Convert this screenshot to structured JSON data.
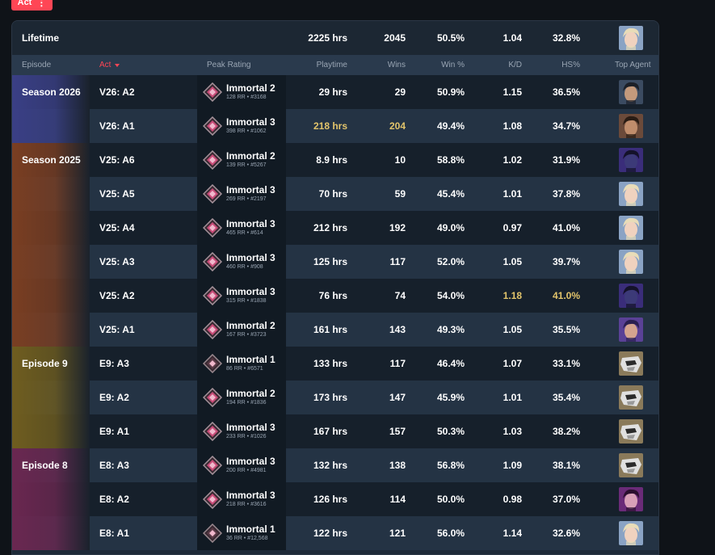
{
  "act_button": {
    "label": "Act",
    "menu_icon": "more-vertical-icon"
  },
  "lifetime": {
    "label": "Lifetime",
    "playtime": "2225 hrs",
    "wins": "2045",
    "win_pct": "50.5%",
    "kd": "1.04",
    "hs_pct": "32.8%",
    "agent": "blonde"
  },
  "headers": {
    "episode": "Episode",
    "act": "Act",
    "peak_rating": "Peak Rating",
    "playtime": "Playtime",
    "wins": "Wins",
    "win_pct": "Win %",
    "kd": "K/D",
    "hs_pct": "HS%",
    "top_agent": "Top Agent"
  },
  "episodes": [
    {
      "label": "Season 2026",
      "rows": 2,
      "color": "#3a3f85"
    },
    {
      "label": "Season 2025",
      "rows": 6,
      "color": "#7a3e22"
    },
    {
      "label": "Episode 9",
      "rows": 3,
      "color": "#6f5d1f"
    },
    {
      "label": "Episode 8",
      "rows": 3,
      "color": "#6a2750"
    }
  ],
  "rows": [
    {
      "act": "V26: A2",
      "rank": "Immortal 2",
      "sub": "128 RR • #3168",
      "playtime": "29 hrs",
      "wins": "29",
      "win_pct": "50.9%",
      "kd": "1.15",
      "hs_pct": "36.5%",
      "agent": "dark"
    },
    {
      "act": "V26: A1",
      "rank": "Immortal 3",
      "sub": "398 RR • #1062",
      "playtime": "218 hrs",
      "wins": "204",
      "win_pct": "49.4%",
      "kd": "1.08",
      "hs_pct": "34.7%",
      "agent": "brown",
      "hl_playtime": true,
      "hl_wins": true
    },
    {
      "act": "V25: A6",
      "rank": "Immortal 2",
      "sub": "139 RR • #5267",
      "playtime": "8.9 hrs",
      "wins": "10",
      "win_pct": "58.8%",
      "kd": "1.02",
      "hs_pct": "31.9%",
      "agent": "violet"
    },
    {
      "act": "V25: A5",
      "rank": "Immortal 3",
      "sub": "269 RR • #2197",
      "playtime": "70 hrs",
      "wins": "59",
      "win_pct": "45.4%",
      "kd": "1.01",
      "hs_pct": "37.8%",
      "agent": "blonde"
    },
    {
      "act": "V25: A4",
      "rank": "Immortal 3",
      "sub": "465 RR • #614",
      "playtime": "212 hrs",
      "wins": "192",
      "win_pct": "49.0%",
      "kd": "0.97",
      "hs_pct": "41.0%",
      "agent": "blonde"
    },
    {
      "act": "V25: A3",
      "rank": "Immortal 3",
      "sub": "460 RR • #908",
      "playtime": "125 hrs",
      "wins": "117",
      "win_pct": "52.0%",
      "kd": "1.05",
      "hs_pct": "39.7%",
      "agent": "blonde"
    },
    {
      "act": "V25: A2",
      "rank": "Immortal 3",
      "sub": "315 RR • #1838",
      "playtime": "76 hrs",
      "wins": "74",
      "win_pct": "54.0%",
      "kd": "1.18",
      "hs_pct": "41.0%",
      "agent": "violet",
      "hl_kd": true,
      "hl_hs": true
    },
    {
      "act": "V25: A1",
      "rank": "Immortal 2",
      "sub": "167 RR • #3723",
      "playtime": "161 hrs",
      "wins": "143",
      "win_pct": "49.3%",
      "kd": "1.05",
      "hs_pct": "35.5%",
      "agent": "purple"
    },
    {
      "act": "E9: A3",
      "rank": "Immortal 1",
      "sub": "86 RR • #6571",
      "playtime": "133 hrs",
      "wins": "117",
      "win_pct": "46.4%",
      "kd": "1.07",
      "hs_pct": "33.1%",
      "agent": "robot"
    },
    {
      "act": "E9: A2",
      "rank": "Immortal 2",
      "sub": "194 RR • #1836",
      "playtime": "173 hrs",
      "wins": "147",
      "win_pct": "45.9%",
      "kd": "1.01",
      "hs_pct": "35.4%",
      "agent": "robot"
    },
    {
      "act": "E9: A1",
      "rank": "Immortal 3",
      "sub": "233 RR • #1026",
      "playtime": "167 hrs",
      "wins": "157",
      "win_pct": "50.3%",
      "kd": "1.03",
      "hs_pct": "38.2%",
      "agent": "robot"
    },
    {
      "act": "E8: A3",
      "rank": "Immortal 3",
      "sub": "200 RR • #4981",
      "playtime": "132 hrs",
      "wins": "138",
      "win_pct": "56.8%",
      "kd": "1.09",
      "hs_pct": "38.1%",
      "agent": "robot"
    },
    {
      "act": "E8: A2",
      "rank": "Immortal 3",
      "sub": "218 RR • #3616",
      "playtime": "126 hrs",
      "wins": "114",
      "win_pct": "50.0%",
      "kd": "0.98",
      "hs_pct": "37.0%",
      "agent": "pink"
    },
    {
      "act": "E8: A1",
      "rank": "Immortal 1",
      "sub": "36 RR • #12,568",
      "playtime": "122 hrs",
      "wins": "121",
      "win_pct": "56.0%",
      "kd": "1.14",
      "hs_pct": "32.6%",
      "agent": "blonde"
    }
  ]
}
